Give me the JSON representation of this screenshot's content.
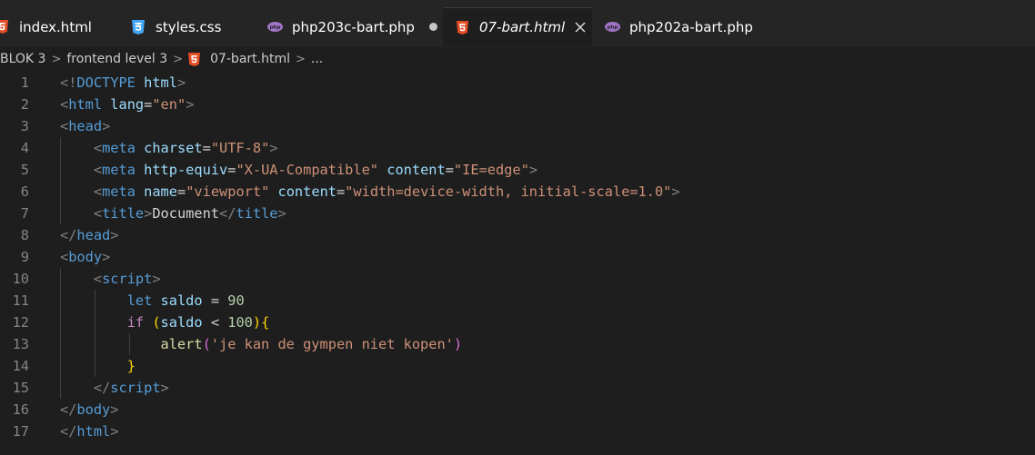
{
  "tabs": [
    {
      "label": "index.html",
      "icon": "html5-icon",
      "active": false
    },
    {
      "label": "styles.css",
      "icon": "css3-icon",
      "active": false
    },
    {
      "label": "php203c-bart.php",
      "icon": "php-icon",
      "active": false,
      "modified": true
    },
    {
      "label": "07-bart.html",
      "icon": "html5-icon",
      "active": true,
      "close_glyph": "✕"
    },
    {
      "label": "php202a-bart.php",
      "icon": "php-icon",
      "active": false
    }
  ],
  "breadcrumb": {
    "items": [
      "BLOK 3",
      "frontend level 3",
      "07-bart.html",
      "..."
    ],
    "separator": ">"
  },
  "editor": {
    "line_numbers": [
      "1",
      "2",
      "3",
      "4",
      "5",
      "6",
      "7",
      "8",
      "9",
      "10",
      "11",
      "12",
      "13",
      "14",
      "15",
      "16",
      "17"
    ],
    "lines": [
      [
        [
          "t-punc",
          "<!"
        ],
        [
          "t-dt",
          "DOCTYPE"
        ],
        [
          "t-txt",
          " "
        ],
        [
          "t-attr",
          "html"
        ],
        [
          "t-punc",
          ">"
        ]
      ],
      [
        [
          "t-punc",
          "<"
        ],
        [
          "t-tag",
          "html"
        ],
        [
          "t-txt",
          " "
        ],
        [
          "t-attr",
          "lang"
        ],
        [
          "t-txt",
          "="
        ],
        [
          "t-str",
          "\"en\""
        ],
        [
          "t-punc",
          ">"
        ]
      ],
      [
        [
          "t-punc",
          "<"
        ],
        [
          "t-tag",
          "head"
        ],
        [
          "t-punc",
          ">"
        ]
      ],
      [
        [
          "t-txt",
          "    "
        ],
        [
          "t-punc",
          "<"
        ],
        [
          "t-tag",
          "meta"
        ],
        [
          "t-txt",
          " "
        ],
        [
          "t-attr",
          "charset"
        ],
        [
          "t-txt",
          "="
        ],
        [
          "t-str",
          "\"UTF-8\""
        ],
        [
          "t-punc",
          ">"
        ]
      ],
      [
        [
          "t-txt",
          "    "
        ],
        [
          "t-punc",
          "<"
        ],
        [
          "t-tag",
          "meta"
        ],
        [
          "t-txt",
          " "
        ],
        [
          "t-attr",
          "http-equiv"
        ],
        [
          "t-txt",
          "="
        ],
        [
          "t-str",
          "\"X-UA-Compatible\""
        ],
        [
          "t-txt",
          " "
        ],
        [
          "t-attr",
          "content"
        ],
        [
          "t-txt",
          "="
        ],
        [
          "t-str",
          "\"IE=edge\""
        ],
        [
          "t-punc",
          ">"
        ]
      ],
      [
        [
          "t-txt",
          "    "
        ],
        [
          "t-punc",
          "<"
        ],
        [
          "t-tag",
          "meta"
        ],
        [
          "t-txt",
          " "
        ],
        [
          "t-attr",
          "name"
        ],
        [
          "t-txt",
          "="
        ],
        [
          "t-str",
          "\"viewport\""
        ],
        [
          "t-txt",
          " "
        ],
        [
          "t-attr",
          "content"
        ],
        [
          "t-txt",
          "="
        ],
        [
          "t-str",
          "\"width=device-width, initial-scale=1.0\""
        ],
        [
          "t-punc",
          ">"
        ]
      ],
      [
        [
          "t-txt",
          "    "
        ],
        [
          "t-punc",
          "<"
        ],
        [
          "t-tag",
          "title"
        ],
        [
          "t-punc",
          ">"
        ],
        [
          "t-txt",
          "Document"
        ],
        [
          "t-punc",
          "</"
        ],
        [
          "t-tag",
          "title"
        ],
        [
          "t-punc",
          ">"
        ]
      ],
      [
        [
          "t-punc",
          "</"
        ],
        [
          "t-tag",
          "head"
        ],
        [
          "t-punc",
          ">"
        ]
      ],
      [
        [
          "t-punc",
          "<"
        ],
        [
          "t-tag",
          "body"
        ],
        [
          "t-punc",
          ">"
        ]
      ],
      [
        [
          "t-txt",
          "    "
        ],
        [
          "t-punc",
          "<"
        ],
        [
          "t-tag",
          "script"
        ],
        [
          "t-punc",
          ">"
        ]
      ],
      [
        [
          "t-txt",
          "        "
        ],
        [
          "t-kw",
          "let"
        ],
        [
          "t-txt",
          " "
        ],
        [
          "t-var",
          "saldo"
        ],
        [
          "t-op",
          " = "
        ],
        [
          "t-num",
          "90"
        ]
      ],
      [
        [
          "t-txt",
          "        "
        ],
        [
          "t-ctl",
          "if"
        ],
        [
          "t-txt",
          " "
        ],
        [
          "t-br1",
          "("
        ],
        [
          "t-var",
          "saldo"
        ],
        [
          "t-op",
          " < "
        ],
        [
          "t-num",
          "100"
        ],
        [
          "t-br1",
          ")"
        ],
        [
          "t-br1",
          "{"
        ]
      ],
      [
        [
          "t-txt",
          "            "
        ],
        [
          "t-fn",
          "alert"
        ],
        [
          "t-br2",
          "("
        ],
        [
          "t-str",
          "'je kan de gympen niet kopen'"
        ],
        [
          "t-br2",
          ")"
        ]
      ],
      [
        [
          "t-txt",
          "        "
        ],
        [
          "t-br1",
          "}"
        ]
      ],
      [
        [
          "t-txt",
          "    "
        ],
        [
          "t-punc",
          "</"
        ],
        [
          "t-tag",
          "script"
        ],
        [
          "t-punc",
          ">"
        ]
      ],
      [
        [
          "t-punc",
          "</"
        ],
        [
          "t-tag",
          "body"
        ],
        [
          "t-punc",
          ">"
        ]
      ],
      [
        [
          "t-punc",
          "</"
        ],
        [
          "t-tag",
          "html"
        ],
        [
          "t-punc",
          ">"
        ]
      ]
    ]
  },
  "colors": {
    "tabbar_bg": "#252526",
    "editor_bg": "#1e1e1e",
    "html_icon": "#e44d26",
    "css_icon": "#42a5f5",
    "php_icon": "#a074c4"
  }
}
